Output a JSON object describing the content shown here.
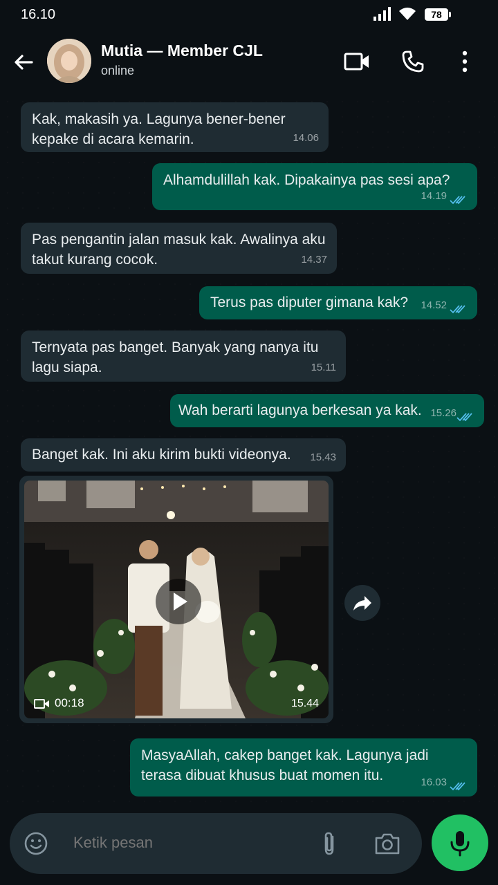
{
  "status_bar": {
    "time": "16.10",
    "battery": "78"
  },
  "header": {
    "name": "Mutia — Member CJL",
    "status": "online"
  },
  "messages": [
    {
      "dir": "in",
      "text": "Kak, makasih ya. Lagunya bener-bener kepake di acara kemarin.",
      "time": "14.06"
    },
    {
      "dir": "out",
      "text": "Alhamdulillah kak. Dipakainya pas sesi apa?",
      "time": "14.19"
    },
    {
      "dir": "in",
      "text": "Pas pengantin jalan masuk kak. Awalinya aku takut kurang cocok.",
      "time": "14.37"
    },
    {
      "dir": "out",
      "text": "Terus pas diputer gimana kak?",
      "time": "14.52"
    },
    {
      "dir": "in",
      "text": "Ternyata pas banget. Banyak yang nanya itu lagu siapa.",
      "time": "15.11"
    },
    {
      "dir": "out",
      "text": "Wah berarti lagunya berkesan ya kak.",
      "time": "15.26"
    },
    {
      "dir": "in",
      "text": "Banget kak. Ini aku kirim bukti videonya.",
      "time": "15.43"
    },
    {
      "dir": "out",
      "text": "MasyaAllah, cakep banget kak. Lagunya jadi terasa dibuat khusus buat momen itu.",
      "time": "16.03"
    }
  ],
  "video": {
    "duration": "00:18",
    "time": "15.44"
  },
  "input": {
    "placeholder": "Ketik pesan"
  },
  "colors": {
    "incoming": "#1f2c33",
    "outgoing": "#005c4b",
    "tick": "#53bdeb",
    "mic": "#21c063"
  }
}
